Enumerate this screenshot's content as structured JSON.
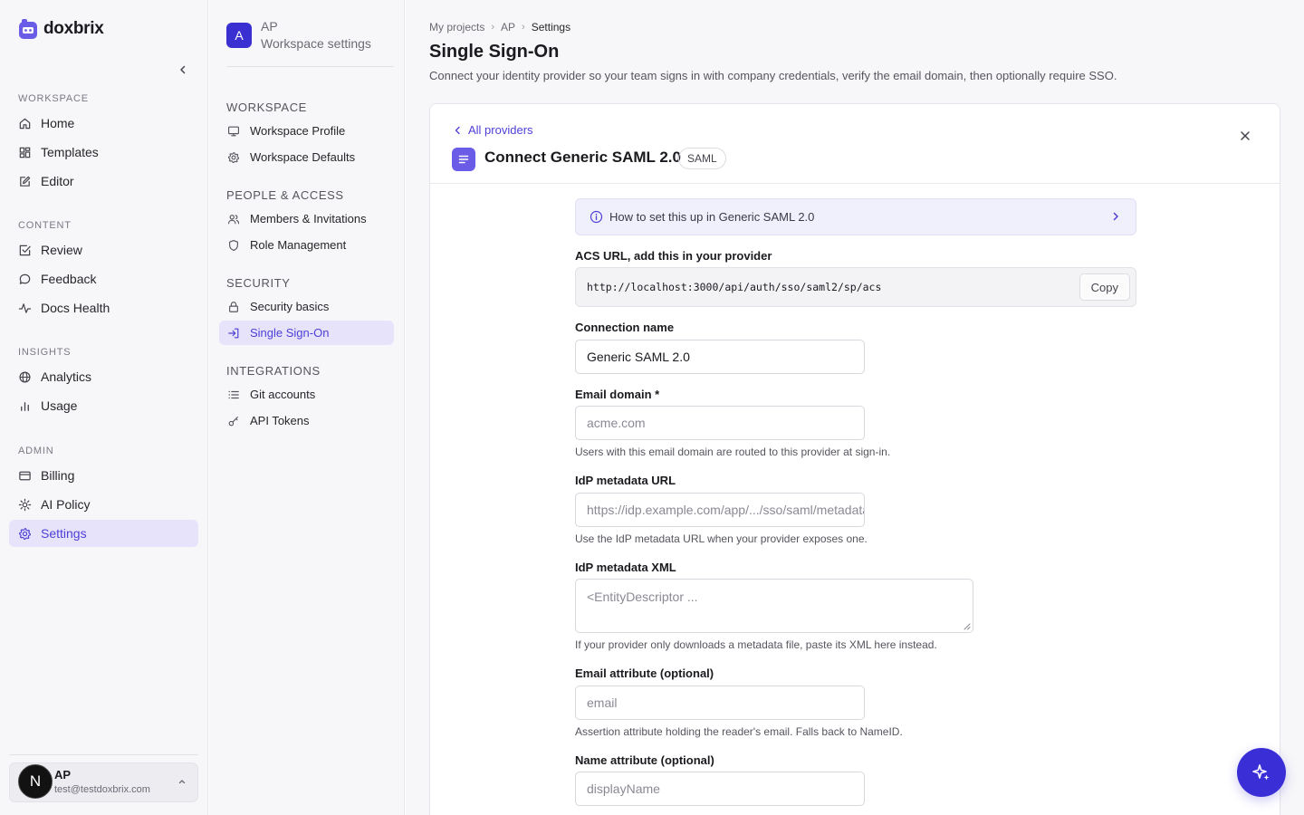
{
  "brand": {
    "name": "doxbrix"
  },
  "sidebar": {
    "sections": [
      {
        "title": "WORKSPACE",
        "items": [
          {
            "label": "Home",
            "icon": "home-icon"
          },
          {
            "label": "Templates",
            "icon": "templates-icon"
          },
          {
            "label": "Editor",
            "icon": "edit-icon"
          }
        ]
      },
      {
        "title": "CONTENT",
        "items": [
          {
            "label": "Review",
            "icon": "review-icon"
          },
          {
            "label": "Feedback",
            "icon": "chat-icon"
          },
          {
            "label": "Docs Health",
            "icon": "pulse-icon"
          }
        ]
      },
      {
        "title": "INSIGHTS",
        "items": [
          {
            "label": "Analytics",
            "icon": "globe-icon"
          },
          {
            "label": "Usage",
            "icon": "bar-chart-icon"
          }
        ]
      },
      {
        "title": "ADMIN",
        "items": [
          {
            "label": "Billing",
            "icon": "card-icon"
          },
          {
            "label": "AI Policy",
            "icon": "sun-icon"
          },
          {
            "label": "Settings",
            "icon": "gear-icon",
            "active": true
          }
        ]
      }
    ],
    "user": {
      "initial": "N",
      "name": "AP",
      "email": "test@testdoxbrix.com"
    }
  },
  "subnav": {
    "workspace_initial": "A",
    "workspace_name": "AP",
    "workspace_sub": "Workspace settings",
    "sections": [
      {
        "title": "WORKSPACE",
        "items": [
          {
            "label": "Workspace Profile",
            "icon": "monitor-icon"
          },
          {
            "label": "Workspace Defaults",
            "icon": "gear-icon"
          }
        ]
      },
      {
        "title": "PEOPLE & ACCESS",
        "items": [
          {
            "label": "Members & Invitations",
            "icon": "users-icon"
          },
          {
            "label": "Role Management",
            "icon": "shield-icon"
          }
        ]
      },
      {
        "title": "SECURITY",
        "items": [
          {
            "label": "Security basics",
            "icon": "lock-icon"
          },
          {
            "label": "Single Sign-On",
            "icon": "sign-in-icon",
            "active": true
          }
        ]
      },
      {
        "title": "INTEGRATIONS",
        "items": [
          {
            "label": "Git accounts",
            "icon": "list-icon"
          },
          {
            "label": "API Tokens",
            "icon": "key-icon"
          }
        ]
      }
    ]
  },
  "breadcrumb": {
    "items": [
      "My projects",
      "AP",
      "Settings"
    ],
    "separator": "›"
  },
  "page": {
    "title": "Single Sign-On",
    "description": "Connect your identity provider so your team signs in with company credentials, verify the email domain, then optionally require SSO."
  },
  "card": {
    "back_label": "All providers",
    "title": "Connect Generic SAML 2.0",
    "badge": "SAML",
    "howto": "How to set this up in Generic SAML 2.0",
    "acs": {
      "label": "ACS URL, add this in your provider",
      "url": "http://localhost:3000/api/auth/sso/saml2/sp/acs",
      "copy_label": "Copy"
    },
    "fields": {
      "connection_name": {
        "label": "Connection name",
        "value": "Generic SAML 2.0"
      },
      "email_domain": {
        "label": "Email domain *",
        "placeholder": "acme.com",
        "hint": "Users with this email domain are routed to this provider at sign-in."
      },
      "metadata_url": {
        "label": "IdP metadata URL",
        "placeholder": "https://idp.example.com/app/.../sso/saml/metadata",
        "hint": "Use the IdP metadata URL when your provider exposes one."
      },
      "metadata_xml": {
        "label": "IdP metadata XML",
        "placeholder": "<EntityDescriptor ...",
        "hint": "If your provider only downloads a metadata file, paste its XML here instead."
      },
      "email_attr": {
        "label": "Email attribute (optional)",
        "placeholder": "email",
        "hint": "Assertion attribute holding the reader's email. Falls back to NameID."
      },
      "name_attr": {
        "label": "Name attribute (optional)",
        "placeholder": "displayName"
      }
    }
  },
  "colors": {
    "accent": "#4e3fd6",
    "fab": "#3a2fd6",
    "active_bg": "#e6e3fb"
  }
}
